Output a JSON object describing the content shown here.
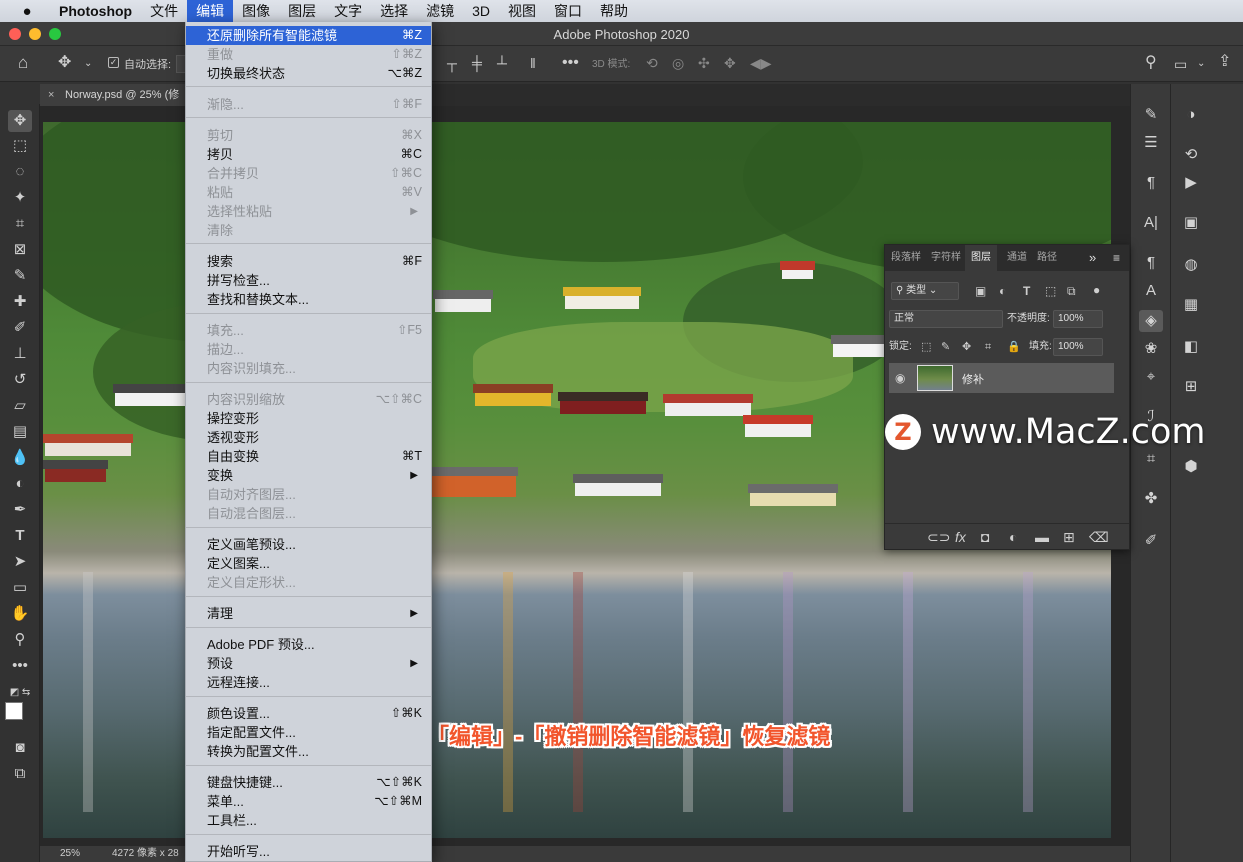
{
  "menubar": {
    "apple_icon": "apple-logo-icon",
    "items": [
      "Photoshop",
      "文件",
      "编辑",
      "图像",
      "图层",
      "文字",
      "选择",
      "滤镜",
      "3D",
      "视图",
      "窗口",
      "帮助"
    ],
    "active_index": 2
  },
  "window": {
    "title": "Adobe Photoshop 2020",
    "traffic_colors": [
      "#ff5f57",
      "#febc2e",
      "#28c840"
    ]
  },
  "options_bar": {
    "auto_select_label": "自动选择:",
    "mode_3d_label": "3D 模式:"
  },
  "document_tab": {
    "close_glyph": "×",
    "label": "Norway.psd @ 25% (修"
  },
  "status_bar": {
    "zoom": "25%",
    "info": "4272 像素 x 28"
  },
  "edit_menu": {
    "items": [
      {
        "label": "还原删除所有智能滤镜",
        "shortcut": "⌘Z",
        "state": "highlighted"
      },
      {
        "label": "重做",
        "shortcut": "⇧⌘Z",
        "state": "disabled"
      },
      {
        "label": "切换最终状态",
        "shortcut": "⌥⌘Z",
        "state": "enabled"
      },
      {
        "label": "渐隐...",
        "shortcut": "⇧⌘F",
        "state": "disabled"
      },
      {
        "label": "剪切",
        "shortcut": "⌘X",
        "state": "disabled"
      },
      {
        "label": "拷贝",
        "shortcut": "⌘C",
        "state": "enabled"
      },
      {
        "label": "合并拷贝",
        "shortcut": "⇧⌘C",
        "state": "disabled"
      },
      {
        "label": "粘贴",
        "shortcut": "⌘V",
        "state": "disabled"
      },
      {
        "label": "选择性粘贴",
        "shortcut": "▶",
        "state": "disabled"
      },
      {
        "label": "清除",
        "shortcut": "",
        "state": "disabled"
      },
      {
        "label": "搜索",
        "shortcut": "⌘F",
        "state": "enabled"
      },
      {
        "label": "拼写检查...",
        "shortcut": "",
        "state": "enabled"
      },
      {
        "label": "查找和替换文本...",
        "shortcut": "",
        "state": "enabled"
      },
      {
        "label": "填充...",
        "shortcut": "⇧F5",
        "state": "disabled"
      },
      {
        "label": "描边...",
        "shortcut": "",
        "state": "disabled"
      },
      {
        "label": "内容识别填充...",
        "shortcut": "",
        "state": "disabled"
      },
      {
        "label": "内容识别缩放",
        "shortcut": "⌥⇧⌘C",
        "state": "disabled"
      },
      {
        "label": "操控变形",
        "shortcut": "",
        "state": "enabled"
      },
      {
        "label": "透视变形",
        "shortcut": "",
        "state": "enabled"
      },
      {
        "label": "自由变换",
        "shortcut": "⌘T",
        "state": "enabled"
      },
      {
        "label": "变换",
        "shortcut": "▶",
        "state": "enabled"
      },
      {
        "label": "自动对齐图层...",
        "shortcut": "",
        "state": "disabled"
      },
      {
        "label": "自动混合图层...",
        "shortcut": "",
        "state": "disabled"
      },
      {
        "label": "定义画笔预设...",
        "shortcut": "",
        "state": "enabled"
      },
      {
        "label": "定义图案...",
        "shortcut": "",
        "state": "enabled"
      },
      {
        "label": "定义自定形状...",
        "shortcut": "",
        "state": "disabled"
      },
      {
        "label": "清理",
        "shortcut": "▶",
        "state": "enabled"
      },
      {
        "label": "Adobe PDF 预设...",
        "shortcut": "",
        "state": "enabled"
      },
      {
        "label": "预设",
        "shortcut": "▶",
        "state": "enabled"
      },
      {
        "label": "远程连接...",
        "shortcut": "",
        "state": "enabled"
      },
      {
        "label": "颜色设置...",
        "shortcut": "⇧⌘K",
        "state": "enabled"
      },
      {
        "label": "指定配置文件...",
        "shortcut": "",
        "state": "enabled"
      },
      {
        "label": "转换为配置文件...",
        "shortcut": "",
        "state": "enabled"
      },
      {
        "label": "键盘快捷键...",
        "shortcut": "⌥⇧⌘K",
        "state": "enabled"
      },
      {
        "label": "菜单...",
        "shortcut": "⌥⇧⌘M",
        "state": "enabled"
      },
      {
        "label": "工具栏...",
        "shortcut": "",
        "state": "enabled"
      },
      {
        "label": "开始听写...",
        "shortcut": "",
        "state": "enabled"
      }
    ]
  },
  "layers_panel": {
    "tabs": [
      "段落样",
      "字符样",
      "图层",
      "通道",
      "路径"
    ],
    "active_tab_index": 2,
    "filter_label": "类型",
    "blend_mode": "正常",
    "opacity_label": "不透明度:",
    "opacity_value": "100%",
    "lock_label": "锁定:",
    "fill_label": "填充:",
    "fill_value": "100%",
    "layer_name": "修补",
    "footer_icons": [
      "link-icon",
      "fx-icon",
      "mask-icon",
      "adjustment-icon",
      "folder-icon",
      "new-layer-icon",
      "trash-icon"
    ]
  },
  "watermark": {
    "logo_letter": "Z",
    "text": "www.MacZ.com"
  },
  "caption": "选择「编辑」-「撤销删除智能滤镜」恢复滤镜"
}
